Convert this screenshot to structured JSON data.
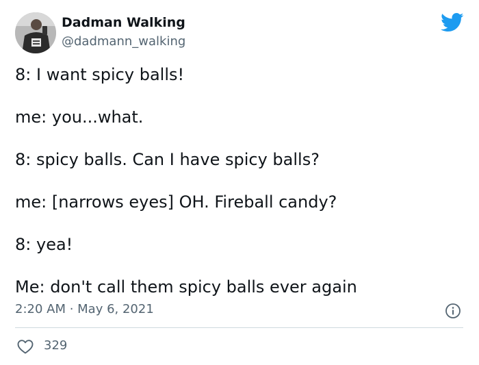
{
  "author": {
    "display_name": "Dadman Walking",
    "handle": "@dadmann_walking",
    "avatar_icon": "profile-photo"
  },
  "brand": {
    "logo_icon": "twitter-bird-icon",
    "accent_color": "#1d9bf0"
  },
  "tweet": {
    "lines": [
      "8: I want spicy balls!",
      "me: you...what.",
      "8: spicy balls. Can I have spicy balls?",
      "me: [narrows eyes] OH. Fireball candy?",
      "8: yea!",
      "Me: don't call them spicy balls ever again"
    ],
    "timestamp": "2:20 AM · May 6, 2021"
  },
  "actions": {
    "like_icon": "heart-icon",
    "like_count": "329",
    "info_icon": "info-icon"
  }
}
